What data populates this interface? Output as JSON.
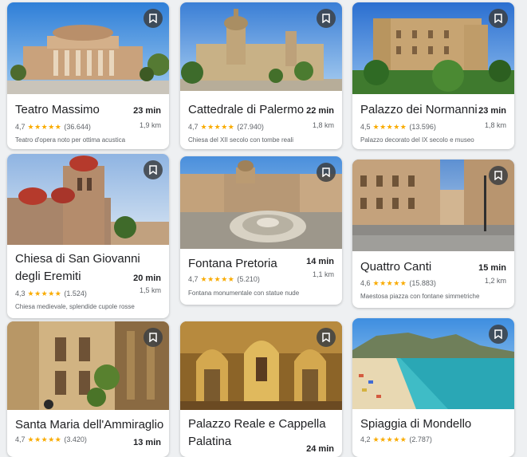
{
  "cards": [
    {
      "title": "Teatro Massimo",
      "time": "23 min",
      "rating": "4,7",
      "stars": "★★★★★",
      "reviews": "(36.644)",
      "distance": "1,9 km",
      "description": "Teatro d'opera noto per ottima acustica"
    },
    {
      "title": "Cattedrale di Palermo",
      "time": "22 min",
      "rating": "4,7",
      "stars": "★★★★★",
      "reviews": "(27.940)",
      "distance": "1,8 km",
      "description": "Chiesa del XII secolo con tombe reali"
    },
    {
      "title": "Palazzo dei Normanni",
      "time": "23 min",
      "rating": "4,5",
      "stars": "★★★★★",
      "reviews": "(13.596)",
      "distance": "1,8 km",
      "description": "Palazzo decorato del IX secolo e museo"
    },
    {
      "title": "Chiesa di San Giovanni degli Eremiti",
      "time": "20 min",
      "rating": "4,3",
      "stars": "★★★★★",
      "reviews": "(1.524)",
      "distance": "1,5 km",
      "description": "Chiesa medievale, splendide cupole rosse"
    },
    {
      "title": "Fontana Pretoria",
      "time": "14 min",
      "rating": "4,7",
      "stars": "★★★★★",
      "reviews": "(5.210)",
      "distance": "1,1 km",
      "description": "Fontana monumentale con statue nude"
    },
    {
      "title": "Quattro Canti",
      "time": "15 min",
      "rating": "4,6",
      "stars": "★★★★★",
      "reviews": "(15.883)",
      "distance": "1,2 km",
      "description": "Maestosa piazza con fontane simmetriche"
    },
    {
      "title": "Santa Maria dell'Ammiraglio",
      "time": "13 min",
      "rating": "4,7",
      "stars": "★★★★★",
      "reviews": "(3.420)"
    },
    {
      "title": "Palazzo Reale e Cappella Palatina",
      "time": "24 min"
    },
    {
      "title": "Spiaggia di Mondello",
      "rating": "4,2",
      "stars": "★★★★★",
      "reviews": "(2.787)"
    }
  ],
  "icons": {
    "save": "bookmark-icon"
  }
}
